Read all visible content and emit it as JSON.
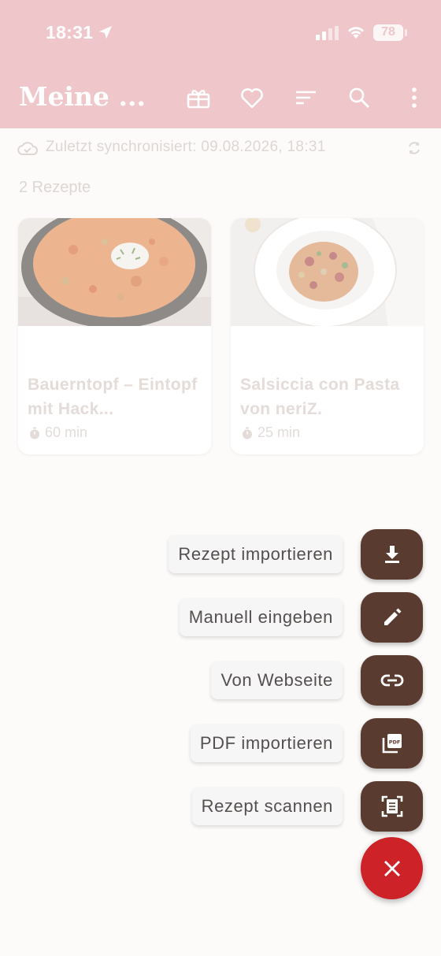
{
  "status_bar": {
    "time": "18:31",
    "battery": "78",
    "icons": [
      "location-arrow-icon",
      "signal-icon",
      "wifi-icon",
      "battery-icon"
    ]
  },
  "header": {
    "title": "Meine ...",
    "icons": [
      "gift-icon",
      "heart-icon",
      "sort-icon",
      "search-icon",
      "more-vert-icon"
    ],
    "background": "#efc7cb"
  },
  "sync": {
    "text": "Zuletzt synchronisiert: 09.08.2026, 18:31",
    "icon": "cloud-done-icon",
    "refresh_icon": "refresh-icon"
  },
  "recipe_count": "2 Rezepte",
  "recipes": [
    {
      "title": "Bauerntopf – Eintopf mit Hack...",
      "time": "60 min",
      "image_icon": "stew-bowl-image"
    },
    {
      "title": "Salsiccia con Pasta von neriZ.",
      "time": "25 min",
      "image_icon": "pasta-plate-image"
    }
  ],
  "speed_dial": {
    "accent": "#5a3b2f",
    "close_color": "#cc2228",
    "actions": [
      {
        "label": "Rezept importieren",
        "icon": "download-icon"
      },
      {
        "label": "Manuell eingeben",
        "icon": "pencil-icon"
      },
      {
        "label": "Von Webseite",
        "icon": "link-icon"
      },
      {
        "label": "PDF importieren",
        "icon": "pdf-icon"
      },
      {
        "label": "Rezept scannen",
        "icon": "document-scanner-icon"
      }
    ],
    "close_icon": "close-icon"
  }
}
